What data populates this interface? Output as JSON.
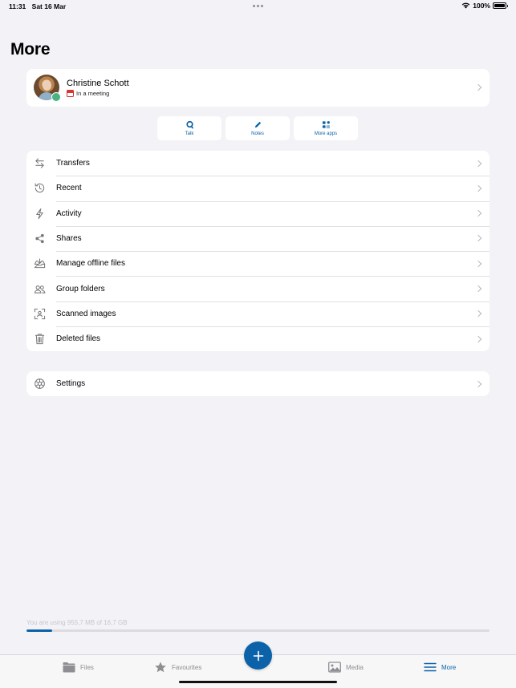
{
  "status_bar": {
    "time": "11:31",
    "date": "Sat 16 Mar",
    "battery": "100%"
  },
  "page_title": "More",
  "profile": {
    "name": "Christine Schott",
    "status": "In a meeting",
    "status_icon": "calendar-icon",
    "online_color": "#49b382"
  },
  "apps": [
    {
      "label": "Talk",
      "icon": "talk-icon"
    },
    {
      "label": "Notes",
      "icon": "pencil-icon"
    },
    {
      "label": "More apps",
      "icon": "apps-grid-icon"
    }
  ],
  "menu": [
    {
      "label": "Transfers",
      "icon": "transfer-arrows-icon"
    },
    {
      "label": "Recent",
      "icon": "history-icon"
    },
    {
      "label": "Activity",
      "icon": "lightning-icon"
    },
    {
      "label": "Shares",
      "icon": "share-icon"
    },
    {
      "label": "Manage offline files",
      "icon": "tray-download-icon"
    },
    {
      "label": "Group folders",
      "icon": "group-icon"
    },
    {
      "label": "Scanned images",
      "icon": "scan-icon"
    },
    {
      "label": "Deleted files",
      "icon": "trash-icon"
    }
  ],
  "settings": {
    "label": "Settings",
    "icon": "gear-icon"
  },
  "storage": {
    "text": "You are using 955,7 MB of 16,7 GB",
    "used_fraction": 0.056
  },
  "tabs": [
    {
      "label": "Files",
      "icon": "folder-icon",
      "active": false
    },
    {
      "label": "Favourites",
      "icon": "star-icon",
      "active": false
    },
    {
      "label": "Media",
      "icon": "image-icon",
      "active": false
    },
    {
      "label": "More",
      "icon": "menu-icon",
      "active": true
    }
  ],
  "colors": {
    "accent": "#0b62a8",
    "background": "#f2f2f7"
  }
}
